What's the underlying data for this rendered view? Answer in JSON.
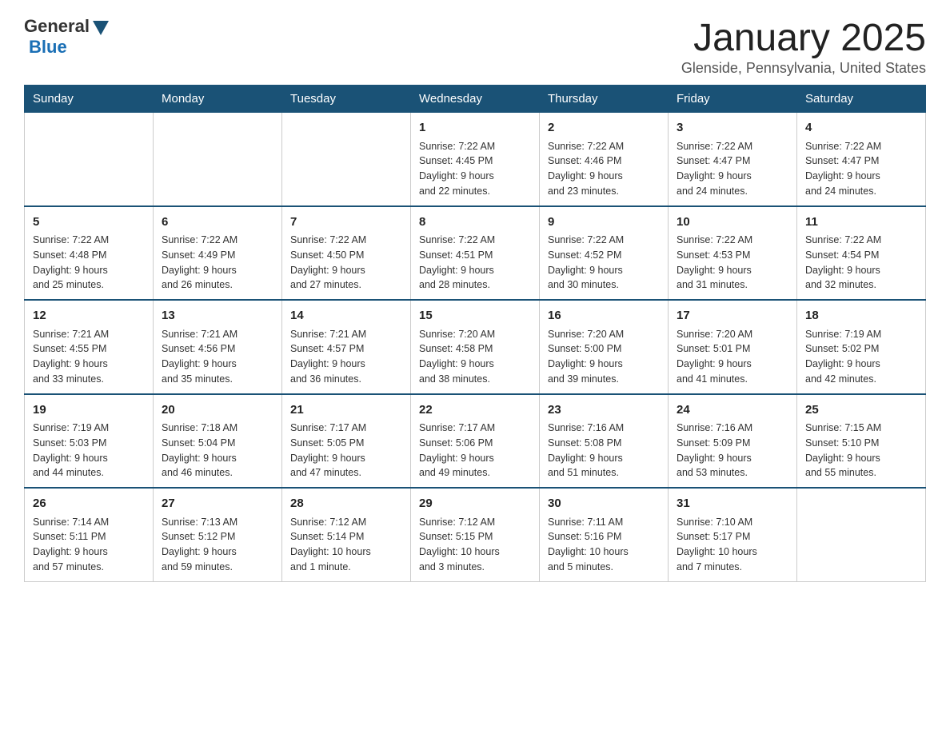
{
  "header": {
    "logo_general": "General",
    "logo_blue": "Blue",
    "title": "January 2025",
    "location": "Glenside, Pennsylvania, United States"
  },
  "weekdays": [
    "Sunday",
    "Monday",
    "Tuesday",
    "Wednesday",
    "Thursday",
    "Friday",
    "Saturday"
  ],
  "weeks": [
    [
      {
        "day": "",
        "info": ""
      },
      {
        "day": "",
        "info": ""
      },
      {
        "day": "",
        "info": ""
      },
      {
        "day": "1",
        "info": "Sunrise: 7:22 AM\nSunset: 4:45 PM\nDaylight: 9 hours\nand 22 minutes."
      },
      {
        "day": "2",
        "info": "Sunrise: 7:22 AM\nSunset: 4:46 PM\nDaylight: 9 hours\nand 23 minutes."
      },
      {
        "day": "3",
        "info": "Sunrise: 7:22 AM\nSunset: 4:47 PM\nDaylight: 9 hours\nand 24 minutes."
      },
      {
        "day": "4",
        "info": "Sunrise: 7:22 AM\nSunset: 4:47 PM\nDaylight: 9 hours\nand 24 minutes."
      }
    ],
    [
      {
        "day": "5",
        "info": "Sunrise: 7:22 AM\nSunset: 4:48 PM\nDaylight: 9 hours\nand 25 minutes."
      },
      {
        "day": "6",
        "info": "Sunrise: 7:22 AM\nSunset: 4:49 PM\nDaylight: 9 hours\nand 26 minutes."
      },
      {
        "day": "7",
        "info": "Sunrise: 7:22 AM\nSunset: 4:50 PM\nDaylight: 9 hours\nand 27 minutes."
      },
      {
        "day": "8",
        "info": "Sunrise: 7:22 AM\nSunset: 4:51 PM\nDaylight: 9 hours\nand 28 minutes."
      },
      {
        "day": "9",
        "info": "Sunrise: 7:22 AM\nSunset: 4:52 PM\nDaylight: 9 hours\nand 30 minutes."
      },
      {
        "day": "10",
        "info": "Sunrise: 7:22 AM\nSunset: 4:53 PM\nDaylight: 9 hours\nand 31 minutes."
      },
      {
        "day": "11",
        "info": "Sunrise: 7:22 AM\nSunset: 4:54 PM\nDaylight: 9 hours\nand 32 minutes."
      }
    ],
    [
      {
        "day": "12",
        "info": "Sunrise: 7:21 AM\nSunset: 4:55 PM\nDaylight: 9 hours\nand 33 minutes."
      },
      {
        "day": "13",
        "info": "Sunrise: 7:21 AM\nSunset: 4:56 PM\nDaylight: 9 hours\nand 35 minutes."
      },
      {
        "day": "14",
        "info": "Sunrise: 7:21 AM\nSunset: 4:57 PM\nDaylight: 9 hours\nand 36 minutes."
      },
      {
        "day": "15",
        "info": "Sunrise: 7:20 AM\nSunset: 4:58 PM\nDaylight: 9 hours\nand 38 minutes."
      },
      {
        "day": "16",
        "info": "Sunrise: 7:20 AM\nSunset: 5:00 PM\nDaylight: 9 hours\nand 39 minutes."
      },
      {
        "day": "17",
        "info": "Sunrise: 7:20 AM\nSunset: 5:01 PM\nDaylight: 9 hours\nand 41 minutes."
      },
      {
        "day": "18",
        "info": "Sunrise: 7:19 AM\nSunset: 5:02 PM\nDaylight: 9 hours\nand 42 minutes."
      }
    ],
    [
      {
        "day": "19",
        "info": "Sunrise: 7:19 AM\nSunset: 5:03 PM\nDaylight: 9 hours\nand 44 minutes."
      },
      {
        "day": "20",
        "info": "Sunrise: 7:18 AM\nSunset: 5:04 PM\nDaylight: 9 hours\nand 46 minutes."
      },
      {
        "day": "21",
        "info": "Sunrise: 7:17 AM\nSunset: 5:05 PM\nDaylight: 9 hours\nand 47 minutes."
      },
      {
        "day": "22",
        "info": "Sunrise: 7:17 AM\nSunset: 5:06 PM\nDaylight: 9 hours\nand 49 minutes."
      },
      {
        "day": "23",
        "info": "Sunrise: 7:16 AM\nSunset: 5:08 PM\nDaylight: 9 hours\nand 51 minutes."
      },
      {
        "day": "24",
        "info": "Sunrise: 7:16 AM\nSunset: 5:09 PM\nDaylight: 9 hours\nand 53 minutes."
      },
      {
        "day": "25",
        "info": "Sunrise: 7:15 AM\nSunset: 5:10 PM\nDaylight: 9 hours\nand 55 minutes."
      }
    ],
    [
      {
        "day": "26",
        "info": "Sunrise: 7:14 AM\nSunset: 5:11 PM\nDaylight: 9 hours\nand 57 minutes."
      },
      {
        "day": "27",
        "info": "Sunrise: 7:13 AM\nSunset: 5:12 PM\nDaylight: 9 hours\nand 59 minutes."
      },
      {
        "day": "28",
        "info": "Sunrise: 7:12 AM\nSunset: 5:14 PM\nDaylight: 10 hours\nand 1 minute."
      },
      {
        "day": "29",
        "info": "Sunrise: 7:12 AM\nSunset: 5:15 PM\nDaylight: 10 hours\nand 3 minutes."
      },
      {
        "day": "30",
        "info": "Sunrise: 7:11 AM\nSunset: 5:16 PM\nDaylight: 10 hours\nand 5 minutes."
      },
      {
        "day": "31",
        "info": "Sunrise: 7:10 AM\nSunset: 5:17 PM\nDaylight: 10 hours\nand 7 minutes."
      },
      {
        "day": "",
        "info": ""
      }
    ]
  ]
}
